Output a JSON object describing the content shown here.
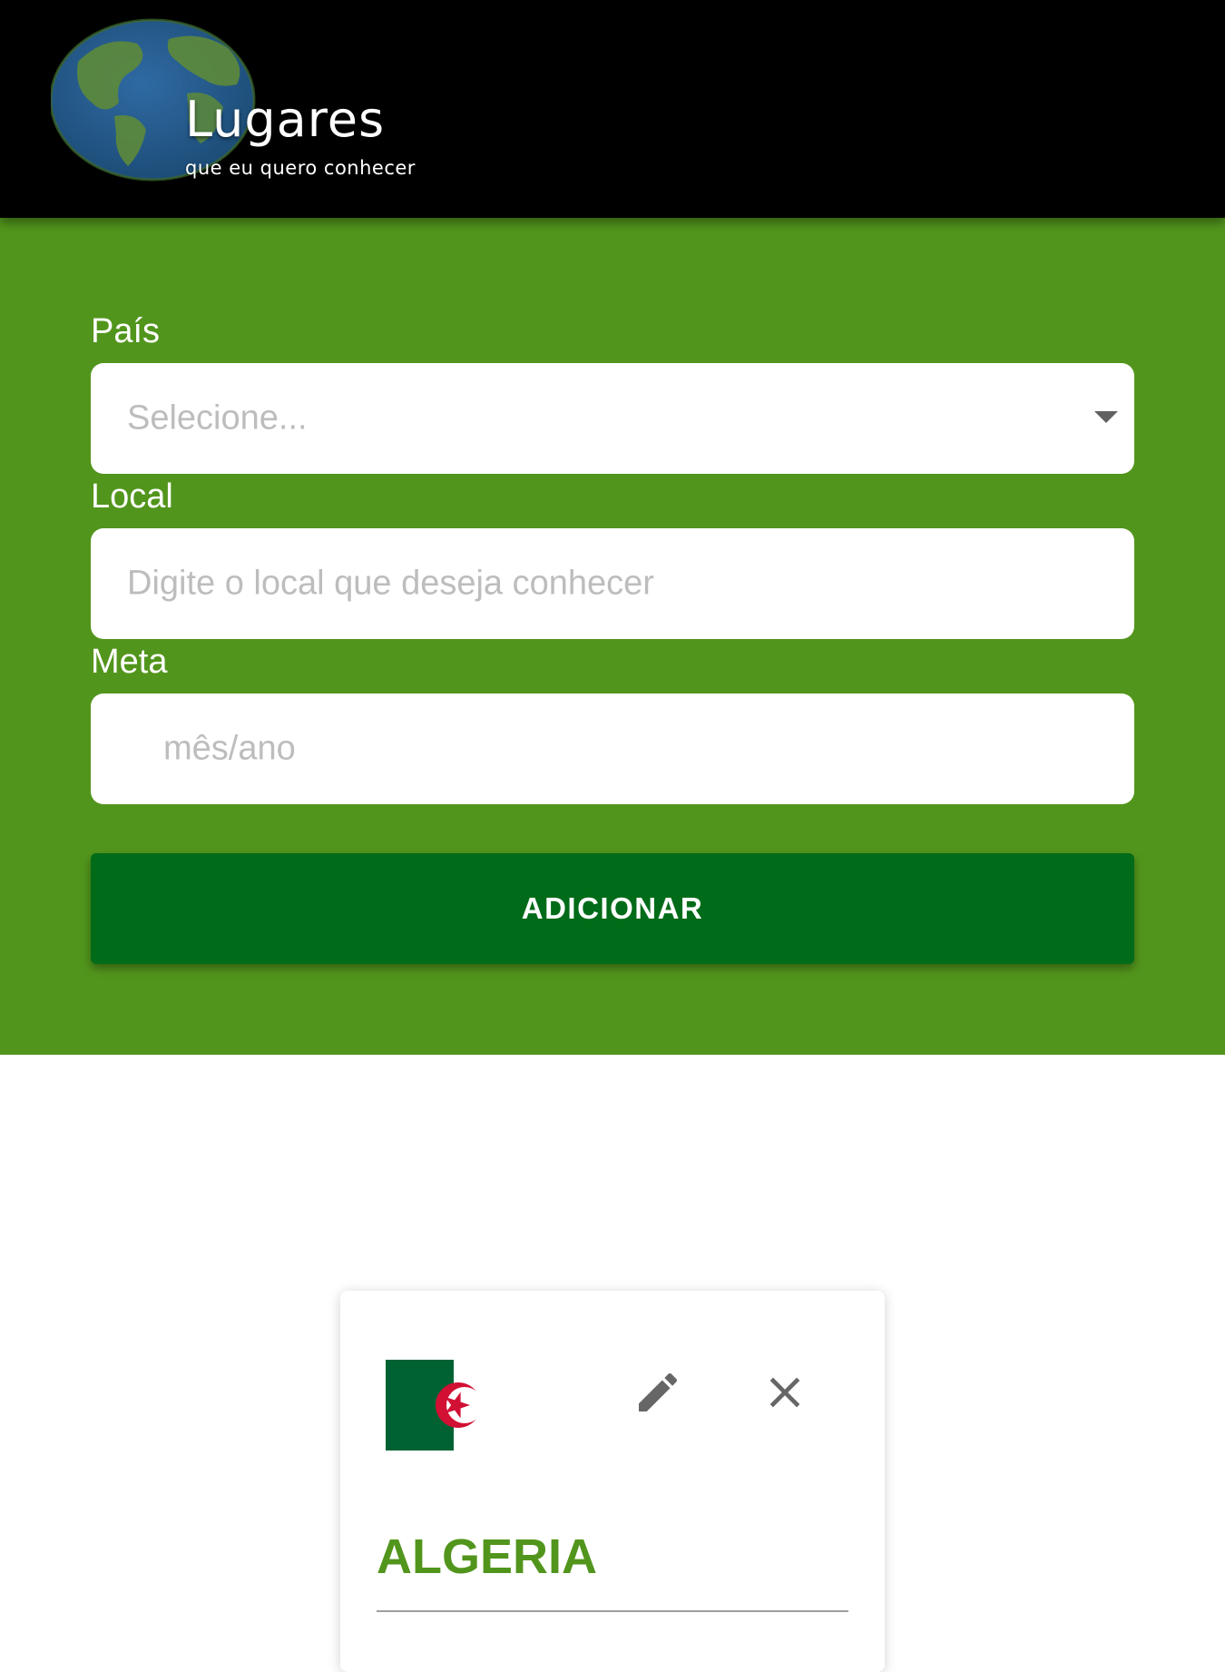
{
  "header": {
    "logo_title": "Lugares",
    "logo_subtitle": "que eu quero conhecer",
    "background_color": "#000000"
  },
  "form": {
    "background_color": "#52951c",
    "country": {
      "label": "País",
      "placeholder": "Selecione..."
    },
    "place": {
      "label": "Local",
      "placeholder": "Digite o local que deseja conhecer"
    },
    "goal": {
      "label": "Meta",
      "placeholder": "mês/ano"
    },
    "submit_label": "ADICIONAR",
    "submit_color": "#006b18"
  },
  "cards": [
    {
      "country": "ALGERIA",
      "flag_icon": "algeria-flag-icon",
      "edit_icon": "pencil-icon",
      "delete_icon": "close-icon"
    }
  ]
}
